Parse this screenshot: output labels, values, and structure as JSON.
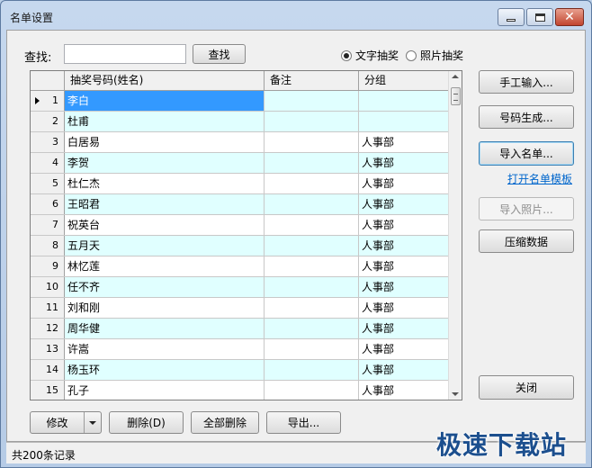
{
  "window": {
    "title": "名单设置"
  },
  "search": {
    "label": "查找:",
    "value": "",
    "button_label": "查找"
  },
  "mode": {
    "options": [
      {
        "label": "文字抽奖",
        "checked": true
      },
      {
        "label": "照片抽奖",
        "checked": false
      }
    ]
  },
  "grid": {
    "columns": [
      "抽奖号码(姓名)",
      "备注",
      "分组"
    ],
    "rows": [
      {
        "index": "1",
        "name": "李白",
        "remark": "",
        "group": ""
      },
      {
        "index": "2",
        "name": "杜甫",
        "remark": "",
        "group": ""
      },
      {
        "index": "3",
        "name": "白居易",
        "remark": "",
        "group": "人事部"
      },
      {
        "index": "4",
        "name": "李贺",
        "remark": "",
        "group": "人事部"
      },
      {
        "index": "5",
        "name": "杜仁杰",
        "remark": "",
        "group": "人事部"
      },
      {
        "index": "6",
        "name": "王昭君",
        "remark": "",
        "group": "人事部"
      },
      {
        "index": "7",
        "name": "祝英台",
        "remark": "",
        "group": "人事部"
      },
      {
        "index": "8",
        "name": "五月天",
        "remark": "",
        "group": "人事部"
      },
      {
        "index": "9",
        "name": "林忆莲",
        "remark": "",
        "group": "人事部"
      },
      {
        "index": "10",
        "name": "任不齐",
        "remark": "",
        "group": "人事部"
      },
      {
        "index": "11",
        "name": "刘和刚",
        "remark": "",
        "group": "人事部"
      },
      {
        "index": "12",
        "name": "周华健",
        "remark": "",
        "group": "人事部"
      },
      {
        "index": "13",
        "name": "许嵩",
        "remark": "",
        "group": "人事部"
      },
      {
        "index": "14",
        "name": "杨玉环",
        "remark": "",
        "group": "人事部"
      },
      {
        "index": "15",
        "name": "孔子",
        "remark": "",
        "group": "人事部"
      }
    ]
  },
  "side_buttons": {
    "manual_input": "手工输入...",
    "generate_numbers": "号码生成...",
    "import_list": "导入名单...",
    "open_template": "打开名单模板",
    "import_photos": "导入照片...",
    "compress_data": "压缩数据",
    "close": "关闭"
  },
  "bottom_buttons": {
    "modify": "修改",
    "delete": "删除(D)",
    "delete_all": "全部删除",
    "export": "导出..."
  },
  "status": {
    "text": "共200条记录"
  },
  "watermark": {
    "text": "极速下载站"
  }
}
